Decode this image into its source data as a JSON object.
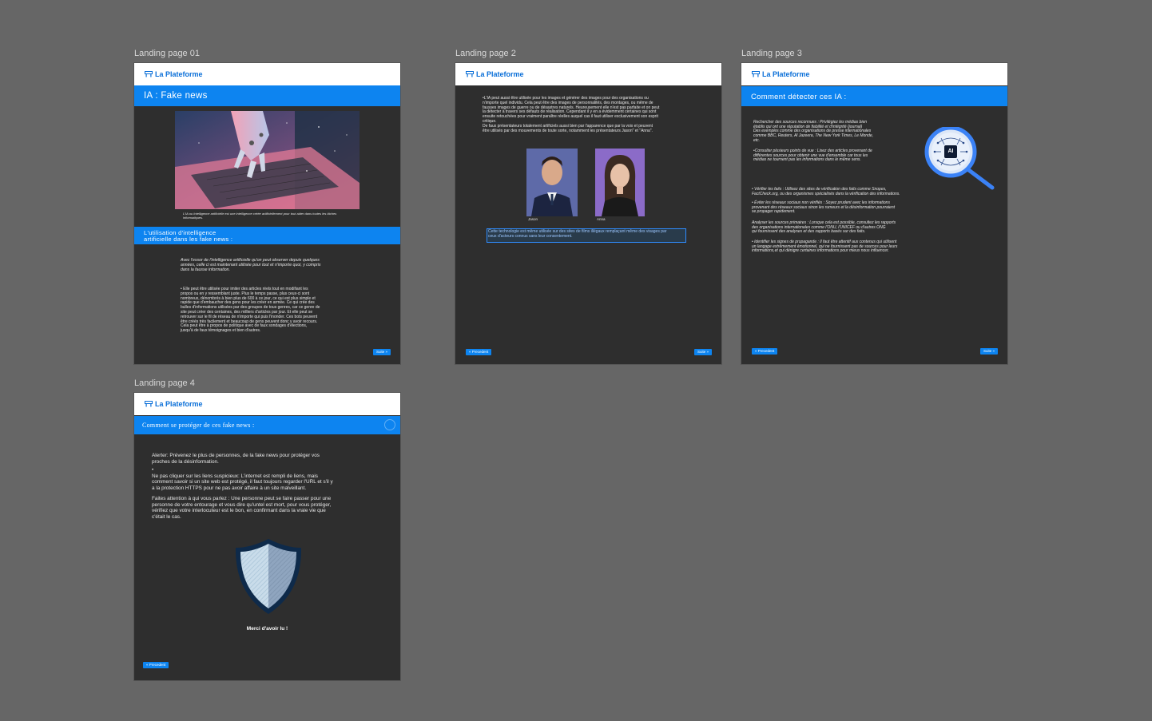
{
  "brand": {
    "name": "La Plateforme",
    "accent": "#0d84f0",
    "logo_color": "#0a6fd8",
    "page_bg": "#2e2e2e",
    "canvas_bg": "#666666"
  },
  "frames": {
    "p1": {
      "label": "Landing page 01",
      "title": "IA : Fake news",
      "image_alt_icon": "robot-hand-laptop-image",
      "caption": "L'IA ou Intelligence artificielle est une intelligence créée artificiellement pour tout aider dans toutes les tâches informatiques.",
      "section_title": "L'utilisation d'intelligence\nartificielle dans les fake news :",
      "intro": "Avec l'essor de l'intelligence artificielle qu'on peut observer depuis quelques\nannées, celle ci est maintenant utilisée pour tout et n'importe quoi, y compris\ndans la fausse information.",
      "body": "• Elle peut être utilisée pour imiter des articles réels tout en modifiant les\npropos ou en y ressemblant juste. Plus le temps passe, plus ceux-ci sont\nnombreux, dénombrés à bien plus de 600 à ce jour, ce qui est plus simple et\nrapide que d'embaucher des gens pour les créer en armée. Ce qui crée des\nbulles d'informations utilisées par des groupes de tous genres, car ce genre de\nsite peut créer des centaines, des milliers d'articles par jour. Et elle peut se\nretrouver sur le fil de réseau de n'importe qui puis l'inonder. Ces bots peuvent\nêtre créés très facilement et beaucoup de gens peuvent donc y avoir recours.\nCela peut être à propos de politique avec de faux sondages d'élections,\njusqu'à de faux témoignages et bien d'autres.",
      "next": "Suite  »"
    },
    "p2": {
      "label": "Landing page 2",
      "body": "•L'IA peut aussi être utilisée pour les images et générer des images pour des organisations ou\nn'importe quel individu. Cela peut être des images de personnalités, des montages, ou même de\nfausses images de guerre ou de désastres naturels. Heureusement elle n'est pas parfaite et on peut\nla détecter à travers ses défauts de réalisation. Cependant il y en a évidemment certaines qui sont\nensuite retouchées pour vraiment paraître réelles auquel cas il faut utiliser exclusivement son esprit\ncritique.\n De faux présentateurs totalement artificiels aussi bien par l'apparence que par la voix et peuvent\nêtre utilisés par des mouvements de toute sorte, notamment les présentateurs Jason\" et \"Anna\".",
      "photo1_name": "Jason",
      "photo2_name": "Anna",
      "selected_text": "Cette technologie est même utilisée sur des sites de films illégaux remplaçant même des visages par\nceux d'acteurs connus sans leur consentement.",
      "prev": "« Precedent",
      "next": "Suite  »"
    },
    "p3": {
      "label": "Landing page 3",
      "title": "Comment détecter ces IA :",
      "ai_badge": "AI",
      "block1": "Rechercher des sources reconnues : Privilégiez les médias bien\nétablis qui ont une réputation de fiabilité et d'intégrité (journal)\nDes exemples comme des organisations de presse internationales\ncomme BBC, Reuters, Al Jazeera, The New York Times, Le Monde,\netc.",
      "block2": "•Consulter plusieurs points de vue : Lisez des articles provenant de\ndifférentes sources pour obtenir une vue d'ensemble car tous les\nmédias ne tournent pas les informations dans le même sens.",
      "block3": "• Vérifier les faits : Utilisez des sites de vérification des faits comme Snopes,\n  FactCheck.org, ou des organismes spécialisés dans la vérification des informations.",
      "block4": "• Éviter les réseaux sociaux non vérifiés : Soyez prudent avec les informations\n  provenant des réseaux sociaux sinon les rumeurs et la désinformation pourraient\n  se propager rapidement.",
      "block5": "  Analyser les sources primaires : Lorsque cela est possible, consultez les rapports\n  des organisations internationales comme l'ONU, l'UNICEF ou d'autres ONG\n  qui fournissent des analyses et des rapports basés sur des faits.",
      "block6": "• Identifier les signes de propagande : Il faut être attentif aux contenus qui utilisent\n  un langage extrêmement émotionnel, qui ne fournissent pas de sources pour leurs\n  informations,et qui dénigre certaines informations pour mieux nous influencer.",
      "prev": "« Precedent",
      "next": "Suite  »"
    },
    "p4": {
      "label": "Landing page 4",
      "title": "Comment se protéger de ces fake news :",
      "tip1": "  Alerter: Prévenez le plus de personnes, de la fake news pour protéger vos\nproches de la désinformation.",
      "tip2": "•\n  Ne pas cliquer sur les liens suspicieux: L'internet est rempli de liens, mais\ncomment savoir si un site web est protégé, il faut toujours regarder l'URL et s'il y\na la protection HTTPS pour ne pas avoir affaire à un site malveillant.",
      "tip3": "  Faites attention à qui vous parlez : Une personne peut se faire passer pour une\npersonne de votre entourage et vous dire qu'untel est mort, pour vous protéger,\nvérifiez que votre interlocuteur est le bon, en confirmant dans la vraie vie que\nc'était le cas.",
      "thanks": "Merci d'avoir lu !",
      "prev": "« Precedent"
    }
  }
}
